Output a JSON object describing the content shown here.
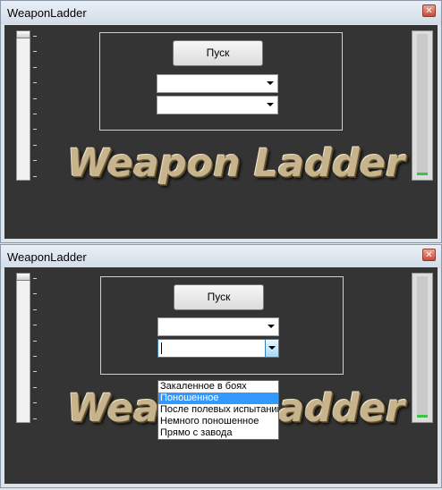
{
  "window1": {
    "title": "WeaponLadder",
    "close_label": "✕",
    "start_button": "Пуск",
    "combo1_value": "",
    "combo2_value": "",
    "logo_text": "Weapon Ladder",
    "slider_value": 0,
    "meter_level": 0.02
  },
  "window2": {
    "title": "WeaponLadder",
    "close_label": "✕",
    "start_button": "Пуск",
    "combo1_value": "",
    "combo2_value": "",
    "logo_text": "Weapon Ladder",
    "slider_value": 0,
    "meter_level": 0.02,
    "dropdown_options": [
      "Закаленное в боях",
      "Поношенное",
      "После полевых испытаний",
      "Немного поношенное",
      "Прямо с завода"
    ],
    "dropdown_selected_index": 1
  },
  "colors": {
    "client_background": "#343434",
    "selection": "#3399ff",
    "meter_fill": "#3ec24a"
  },
  "icons": [
    "close-icon",
    "dropdown-arrow-icon"
  ]
}
